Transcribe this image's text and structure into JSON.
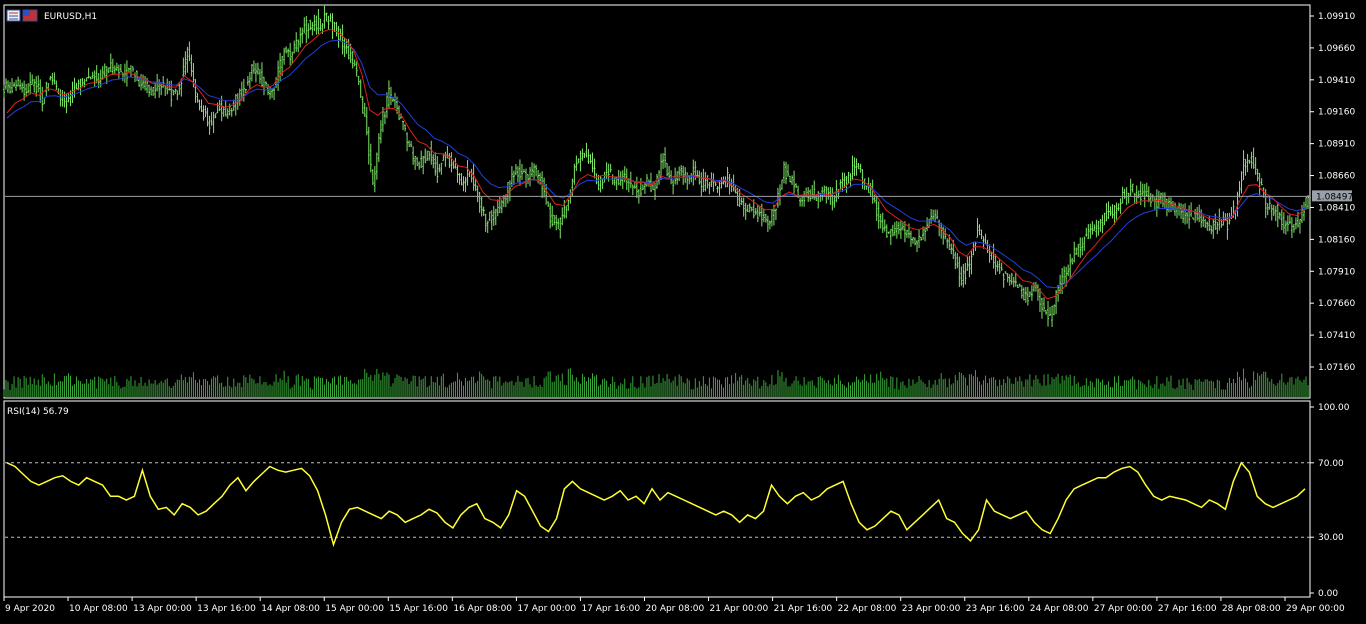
{
  "window": {
    "symbol_title": "EURUSD,H1",
    "current_price_label": "1.08497"
  },
  "colors": {
    "background": "#000000",
    "grid_frame": "#ffffff",
    "candle_up": "#7ee868",
    "candle_down": "#7ee868",
    "volume": "#3aa83a",
    "ma_fast": "#e0201a",
    "ma_slow": "#2040e0",
    "rsi_line": "#ffff33",
    "bid_line": "#a0a0a0",
    "price_tag_bg": "#9aa0a8"
  },
  "rsi_panel": {
    "label": "RSI(14) 56.79",
    "levels": [
      "100.00",
      "70.00",
      "30.00",
      "0.00"
    ]
  },
  "chart_data": {
    "type": "line",
    "timeframe": "H1",
    "price_ylim": [
      1.0716,
      1.0991
    ],
    "price_ticks": [
      "1.09910",
      "1.09660",
      "1.09410",
      "1.09160",
      "1.08910",
      "1.08660",
      "1.08410",
      "1.08160",
      "1.07910",
      "1.07660",
      "1.07410",
      "1.07160"
    ],
    "x_ticks": [
      "9 Apr 2020",
      "10 Apr 08:00",
      "13 Apr 00:00",
      "13 Apr 16:00",
      "14 Apr 08:00",
      "15 Apr 00:00",
      "15 Apr 16:00",
      "16 Apr 08:00",
      "17 Apr 00:00",
      "17 Apr 16:00",
      "20 Apr 08:00",
      "21 Apr 00:00",
      "21 Apr 16:00",
      "22 Apr 08:00",
      "23 Apr 00:00",
      "23 Apr 16:00",
      "24 Apr 08:00",
      "27 Apr 00:00",
      "27 Apr 16:00",
      "28 Apr 08:00",
      "29 Apr 00:00"
    ],
    "series": [
      {
        "name": "EURUSD,H1",
        "kind": "price",
        "values": [
          1.0935,
          1.0938,
          1.0933,
          1.094,
          1.0925,
          1.0945,
          1.093,
          1.0922,
          1.0936,
          1.094,
          1.0945,
          1.0942,
          1.0948,
          1.0952,
          1.0945,
          1.095,
          1.094,
          1.0935,
          1.0932,
          1.0938,
          1.093,
          1.0935,
          1.0962,
          1.093,
          1.0915,
          1.0905,
          1.092,
          1.0915,
          1.0925,
          1.0932,
          1.095,
          1.0945,
          1.093,
          1.094,
          1.0965,
          1.096,
          1.0975,
          1.0985,
          1.0982,
          1.099,
          1.0985,
          1.0975,
          1.0962,
          1.0945,
          1.091,
          1.086,
          1.0905,
          1.093,
          1.0918,
          1.09,
          1.088,
          1.0875,
          1.0885,
          1.087,
          1.0882,
          1.0875,
          1.086,
          1.087,
          1.085,
          1.083,
          1.0835,
          1.0845,
          1.086,
          1.087,
          1.0865,
          1.087,
          1.086,
          1.0835,
          1.0825,
          1.084,
          1.087,
          1.0885,
          1.0875,
          1.086,
          1.087,
          1.0862,
          1.0865,
          1.086,
          1.0855,
          1.086,
          1.0855,
          1.088,
          1.086,
          1.087,
          1.0865,
          1.0868,
          1.086,
          1.0862,
          1.0855,
          1.0865,
          1.085,
          1.084,
          1.084,
          1.0835,
          1.083,
          1.084,
          1.087,
          1.086,
          1.0845,
          1.0852,
          1.085,
          1.0855,
          1.0848,
          1.086,
          1.0865,
          1.0875,
          1.086,
          1.085,
          1.083,
          1.082,
          1.0825,
          1.0822,
          1.0815,
          1.082,
          1.083,
          1.0832,
          1.0815,
          1.0805,
          1.0785,
          1.0795,
          1.0825,
          1.081,
          1.08,
          1.079,
          1.0785,
          1.078,
          1.077,
          1.078,
          1.0765,
          1.0755,
          1.0775,
          1.079,
          1.0805,
          1.0815,
          1.0822,
          1.0825,
          1.0835,
          1.0838,
          1.085,
          1.0855,
          1.0852,
          1.085,
          1.0845,
          1.0848,
          1.084,
          1.0838,
          1.0835,
          1.0835,
          1.0832,
          1.0825,
          1.083,
          1.0828,
          1.084,
          1.0875,
          1.088,
          1.086,
          1.084,
          1.084,
          1.0828,
          1.0825,
          1.0832,
          1.0849
        ]
      },
      {
        "name": "RSI(14)",
        "kind": "rsi",
        "ylim": [
          0,
          100
        ],
        "values": [
          70,
          68,
          64,
          60,
          58,
          60,
          62,
          63,
          60,
          58,
          62,
          60,
          58,
          52,
          52,
          50,
          52,
          66,
          52,
          45,
          46,
          42,
          48,
          46,
          42,
          44,
          48,
          52,
          58,
          62,
          55,
          60,
          64,
          68,
          66,
          65,
          66,
          67,
          63,
          55,
          42,
          26,
          38,
          45,
          46,
          44,
          42,
          40,
          44,
          42,
          38,
          40,
          42,
          45,
          43,
          38,
          35,
          42,
          46,
          48,
          40,
          38,
          35,
          42,
          55,
          52,
          44,
          36,
          33,
          40,
          56,
          60,
          56,
          54,
          52,
          50,
          52,
          55,
          50,
          52,
          48,
          56,
          50,
          54,
          52,
          50,
          48,
          46,
          44,
          42,
          44,
          42,
          38,
          42,
          40,
          44,
          58,
          52,
          48,
          52,
          54,
          50,
          52,
          56,
          58,
          60,
          48,
          38,
          34,
          36,
          40,
          44,
          42,
          34,
          38,
          42,
          46,
          50,
          40,
          38,
          32,
          28,
          34,
          50,
          44,
          42,
          40,
          42,
          44,
          38,
          34,
          32,
          40,
          50,
          56,
          58,
          60,
          62,
          62,
          65,
          67,
          68,
          65,
          58,
          52,
          50,
          52,
          51,
          50,
          48,
          46,
          50,
          48,
          45,
          60,
          70,
          65,
          52,
          48,
          46,
          48,
          50,
          52,
          56
        ]
      },
      {
        "name": "MA fast",
        "kind": "overlay",
        "color": "#e0201a"
      },
      {
        "name": "MA slow",
        "kind": "overlay",
        "color": "#2040e0"
      },
      {
        "name": "Volume",
        "kind": "histogram"
      }
    ],
    "current_price": 1.08497,
    "rsi_levels": [
      70,
      30
    ]
  }
}
